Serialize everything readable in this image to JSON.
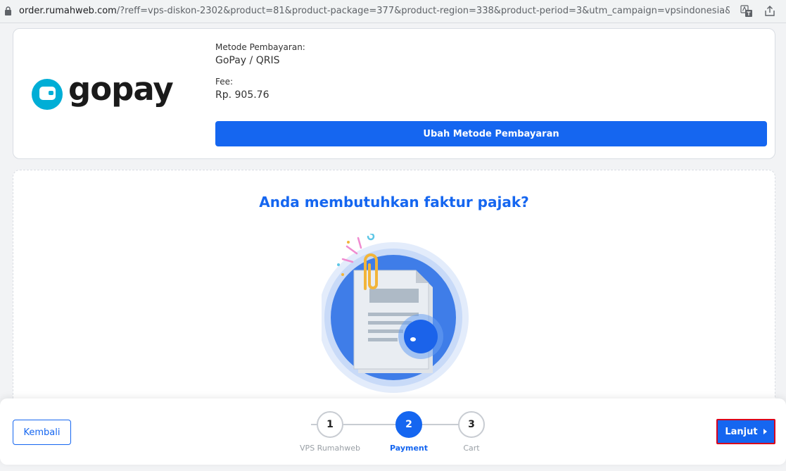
{
  "browser": {
    "url_host": "order.rumahweb.com",
    "url_rest": "/?reff=vps-diskon-2302&product=81&product-package=377&product-region=338&product-period=3&utm_campaign=vpsindonesia&utm..."
  },
  "payment": {
    "logo_text": "gopay",
    "method_label": "Metode Pembayaran:",
    "method_value": "GoPay / QRIS",
    "fee_label": "Fee:",
    "fee_value": "Rp. 905.76",
    "change_button": "Ubah Metode Pembayaran"
  },
  "tax": {
    "title": "Anda membutuhkan faktur pajak?"
  },
  "footer": {
    "back_button": "Kembali",
    "next_button": "Lanjut",
    "steps": [
      {
        "number": "1",
        "label": "VPS Rumahweb",
        "active": false
      },
      {
        "number": "2",
        "label": "Payment",
        "active": true
      },
      {
        "number": "3",
        "label": "Cart",
        "active": false
      }
    ]
  },
  "colors": {
    "accent": "#1566f0",
    "gopay": "#00aed6",
    "highlight": "#d9001b"
  }
}
